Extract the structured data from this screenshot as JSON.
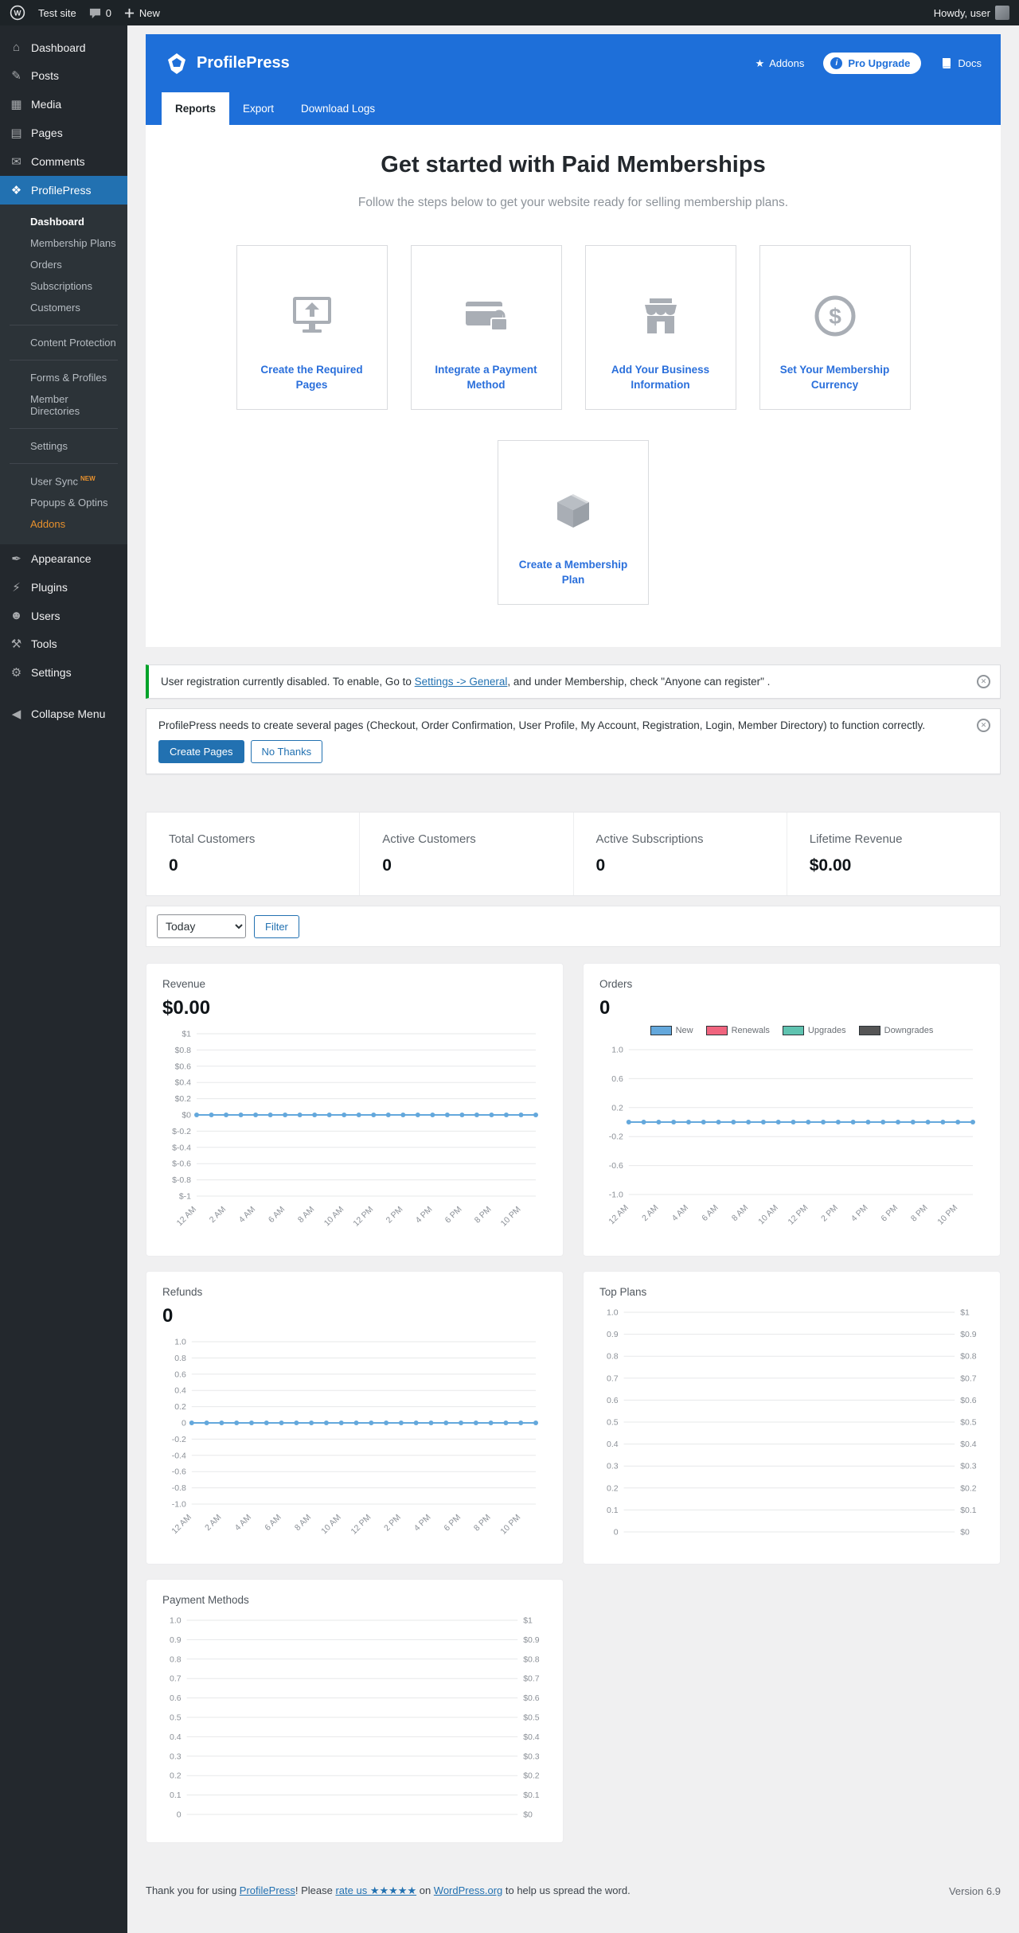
{
  "colors": {
    "brand_blue": "#1e6fd9",
    "admin_bar_dark": "#1d2327",
    "sidebar_dark": "#23282d",
    "active_menu_blue": "#2271b1",
    "notice_green": "#00a32a",
    "link_blue": "#2271b1",
    "chart_line_blue": "#64a8dc",
    "step_icon_gray": "#a9aeb5"
  },
  "icons": {
    "dismiss": "✕",
    "star": "★",
    "info": "i",
    "menu": {
      "dashboard": "⌂",
      "posts": "✎",
      "media": "▦",
      "pages": "▤",
      "comments": "✉",
      "profilepress": "❖",
      "appearance": "✒",
      "plugins": "⚡",
      "users": "☻",
      "tools": "⚒",
      "settings": "⚙",
      "collapse": "◀"
    }
  },
  "admin_bar": {
    "site_name": "Test site",
    "comments_count": "0",
    "new_label": "New",
    "howdy": "Howdy, user"
  },
  "sidebar": {
    "items": [
      {
        "label": "Dashboard"
      },
      {
        "label": "Posts"
      },
      {
        "label": "Media"
      },
      {
        "label": "Pages"
      },
      {
        "label": "Comments"
      },
      {
        "label": "ProfilePress"
      },
      {
        "label": "Appearance"
      },
      {
        "label": "Plugins"
      },
      {
        "label": "Users"
      },
      {
        "label": "Tools"
      },
      {
        "label": "Settings"
      },
      {
        "label": "Collapse Menu"
      }
    ],
    "submenu": [
      {
        "label": "Dashboard"
      },
      {
        "label": "Membership Plans"
      },
      {
        "label": "Orders"
      },
      {
        "label": "Subscriptions"
      },
      {
        "label": "Customers"
      },
      {
        "label": "Content Protection"
      },
      {
        "label": "Forms & Profiles"
      },
      {
        "label": "Member Directories"
      },
      {
        "label": "Settings"
      },
      {
        "label": "User Sync",
        "badge": "NEW"
      },
      {
        "label": "Popups & Optins"
      },
      {
        "label": "Addons"
      }
    ]
  },
  "header": {
    "brand": "ProfilePress",
    "addons_label": "Addons",
    "pro_upgrade_label": "Pro Upgrade",
    "docs_label": "Docs",
    "tabs": [
      {
        "label": "Reports"
      },
      {
        "label": "Export"
      },
      {
        "label": "Download Logs"
      }
    ]
  },
  "onboarding": {
    "title": "Get started with Paid Memberships",
    "subtitle": "Follow the steps below to get your website ready for selling membership plans.",
    "steps": [
      {
        "label": "Create the Required Pages"
      },
      {
        "label": "Integrate a Payment Method"
      },
      {
        "label": "Add Your Business Information"
      },
      {
        "label": "Set Your Membership Currency"
      },
      {
        "label": "Create a Membership Plan"
      }
    ]
  },
  "notices": {
    "registration": {
      "text_before": "User registration currently disabled. To enable, Go to ",
      "link": "Settings -> General",
      "text_after": ", and under Membership, check \"Anyone can register\" ."
    },
    "pages": {
      "text": "ProfilePress needs to create several pages (Checkout, Order Confirmation, User Profile, My Account, Registration, Login, Member Directory) to function correctly.",
      "primary": "Create Pages",
      "secondary": "No Thanks"
    }
  },
  "stats": [
    {
      "label": "Total Customers",
      "value": "0"
    },
    {
      "label": "Active Customers",
      "value": "0"
    },
    {
      "label": "Active Subscriptions",
      "value": "0"
    },
    {
      "label": "Lifetime Revenue",
      "value": "$0.00"
    }
  ],
  "filter": {
    "selected": "Today",
    "button": "Filter"
  },
  "chart_data": [
    {
      "type": "line",
      "name": "revenue",
      "title": "Revenue",
      "big_value": "$0.00",
      "ylim": [
        -1,
        1
      ],
      "y_ticks": [
        "$1",
        "$0.8",
        "$0.6",
        "$0.4",
        "$0.2",
        "$0",
        "$-0.2",
        "$-0.4",
        "$-0.6",
        "$-0.8",
        "$-1"
      ],
      "right_y_ticks": [],
      "x_tick_labels": [
        "12 AM",
        "2 AM",
        "4 AM",
        "6 AM",
        "8 AM",
        "10 AM",
        "12 PM",
        "2 PM",
        "4 PM",
        "6 PM",
        "8 PM",
        "10 PM"
      ],
      "series": [
        {
          "name": "Revenue",
          "color": "#64a8dc",
          "values": [
            0,
            0,
            0,
            0,
            0,
            0,
            0,
            0,
            0,
            0,
            0,
            0,
            0,
            0,
            0,
            0,
            0,
            0,
            0,
            0,
            0,
            0,
            0,
            0
          ]
        }
      ],
      "legend": []
    },
    {
      "type": "line",
      "name": "orders",
      "title": "Orders",
      "big_value": "0",
      "ylim": [
        -1,
        1
      ],
      "y_ticks": [
        "1.0",
        "0.6",
        "0.2",
        "-0.2",
        "-0.6",
        "-1.0"
      ],
      "right_y_ticks": [],
      "x_tick_labels": [
        "12 AM",
        "2 AM",
        "4 AM",
        "6 AM",
        "8 AM",
        "10 AM",
        "12 PM",
        "2 PM",
        "4 PM",
        "6 PM",
        "8 PM",
        "10 PM"
      ],
      "series": [
        {
          "name": "New",
          "color": "#64a8dc",
          "values": [
            0,
            0,
            0,
            0,
            0,
            0,
            0,
            0,
            0,
            0,
            0,
            0,
            0,
            0,
            0,
            0,
            0,
            0,
            0,
            0,
            0,
            0,
            0,
            0
          ]
        }
      ],
      "legend": [
        {
          "label": "New",
          "color": "#64a8dc"
        },
        {
          "label": "Renewals",
          "color": "#f0647e"
        },
        {
          "label": "Upgrades",
          "color": "#5fc3b0"
        },
        {
          "label": "Downgrades",
          "color": "#555555"
        }
      ]
    },
    {
      "type": "line",
      "name": "refunds",
      "title": "Refunds",
      "big_value": "0",
      "ylim": [
        -1,
        1
      ],
      "y_ticks": [
        "1.0",
        "0.8",
        "0.6",
        "0.4",
        "0.2",
        "0",
        "-0.2",
        "-0.4",
        "-0.6",
        "-0.8",
        "-1.0"
      ],
      "right_y_ticks": [],
      "x_tick_labels": [
        "12 AM",
        "2 AM",
        "4 AM",
        "6 AM",
        "8 AM",
        "10 AM",
        "12 PM",
        "2 PM",
        "4 PM",
        "6 PM",
        "8 PM",
        "10 PM"
      ],
      "series": [
        {
          "name": "Refunds",
          "color": "#64a8dc",
          "values": [
            0,
            0,
            0,
            0,
            0,
            0,
            0,
            0,
            0,
            0,
            0,
            0,
            0,
            0,
            0,
            0,
            0,
            0,
            0,
            0,
            0,
            0,
            0,
            0
          ]
        }
      ],
      "legend": []
    },
    {
      "type": "line",
      "name": "top_plans",
      "title": "Top Plans",
      "big_value": "",
      "ylim": [
        0,
        1
      ],
      "y_ticks": [
        "1.0",
        "0.9",
        "0.8",
        "0.7",
        "0.6",
        "0.5",
        "0.4",
        "0.3",
        "0.2",
        "0.1",
        "0"
      ],
      "right_y_ticks": [
        "$1",
        "$0.9",
        "$0.8",
        "$0.7",
        "$0.6",
        "$0.5",
        "$0.4",
        "$0.3",
        "$0.2",
        "$0.1",
        "$0"
      ],
      "x_tick_labels": [],
      "series": [],
      "legend": []
    },
    {
      "type": "line",
      "name": "payment_methods",
      "title": "Payment Methods",
      "big_value": "",
      "ylim": [
        0,
        1
      ],
      "y_ticks": [
        "1.0",
        "0.9",
        "0.8",
        "0.7",
        "0.6",
        "0.5",
        "0.4",
        "0.3",
        "0.2",
        "0.1",
        "0"
      ],
      "right_y_ticks": [
        "$1",
        "$0.9",
        "$0.8",
        "$0.7",
        "$0.6",
        "$0.5",
        "$0.4",
        "$0.3",
        "$0.2",
        "$0.1",
        "$0"
      ],
      "x_tick_labels": [],
      "series": [],
      "legend": []
    }
  ],
  "footer": {
    "before": "Thank you for using ",
    "link1": "ProfilePress",
    "mid1": "! Please ",
    "link2": "rate us ★★★★★",
    "mid2": " on ",
    "link3": "WordPress.org",
    "after": " to help us spread the word.",
    "version": "Version 6.9"
  }
}
